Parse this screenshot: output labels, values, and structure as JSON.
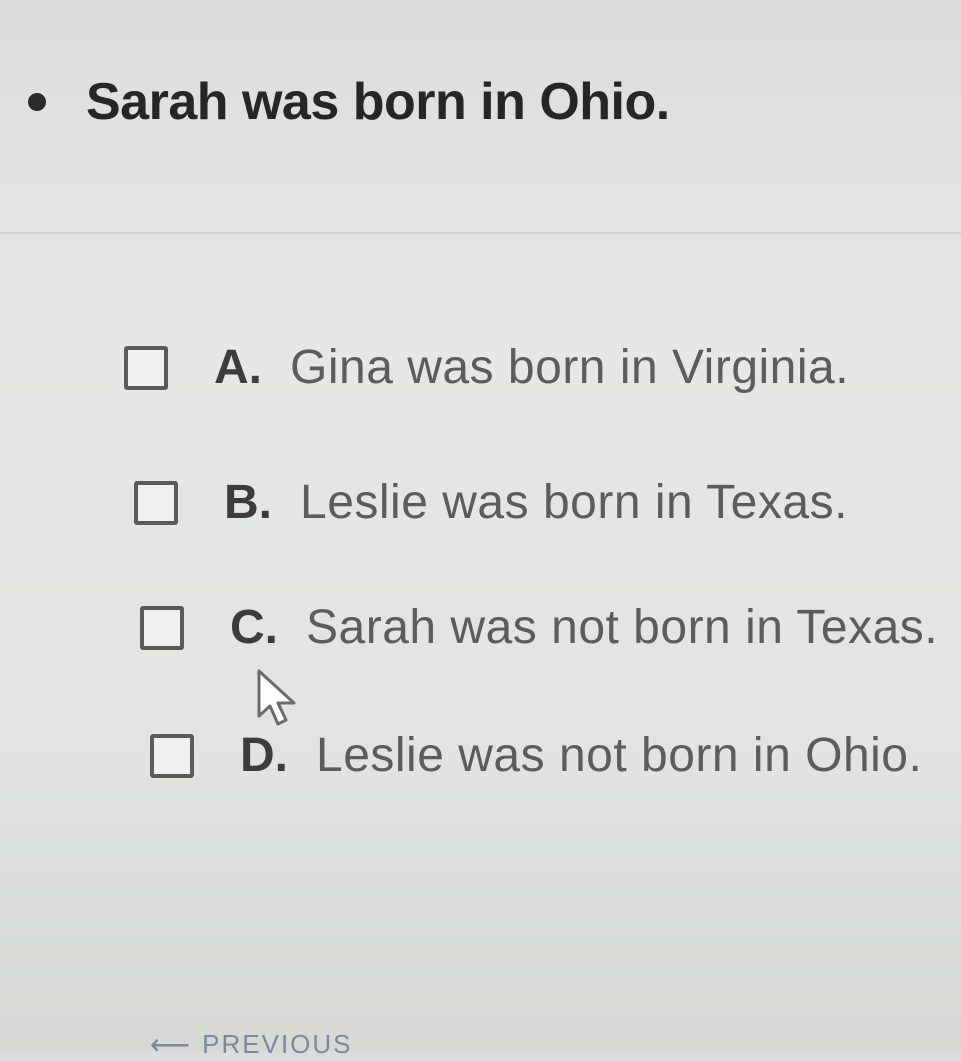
{
  "premise": {
    "text": "Sarah was born in Ohio."
  },
  "options": [
    {
      "letter": "A.",
      "text": "Gina was born in Virginia."
    },
    {
      "letter": "B.",
      "text": "Leslie was born in Texas."
    },
    {
      "letter": "C.",
      "text": "Sarah was not born in Texas."
    },
    {
      "letter": "D.",
      "text": "Leslie was not born in Ohio."
    }
  ],
  "navigation": {
    "previous_label": "PREVIOUS"
  },
  "icons": {
    "cursor": "mouse-pointer-icon",
    "previous": "arrow-left-icon"
  }
}
